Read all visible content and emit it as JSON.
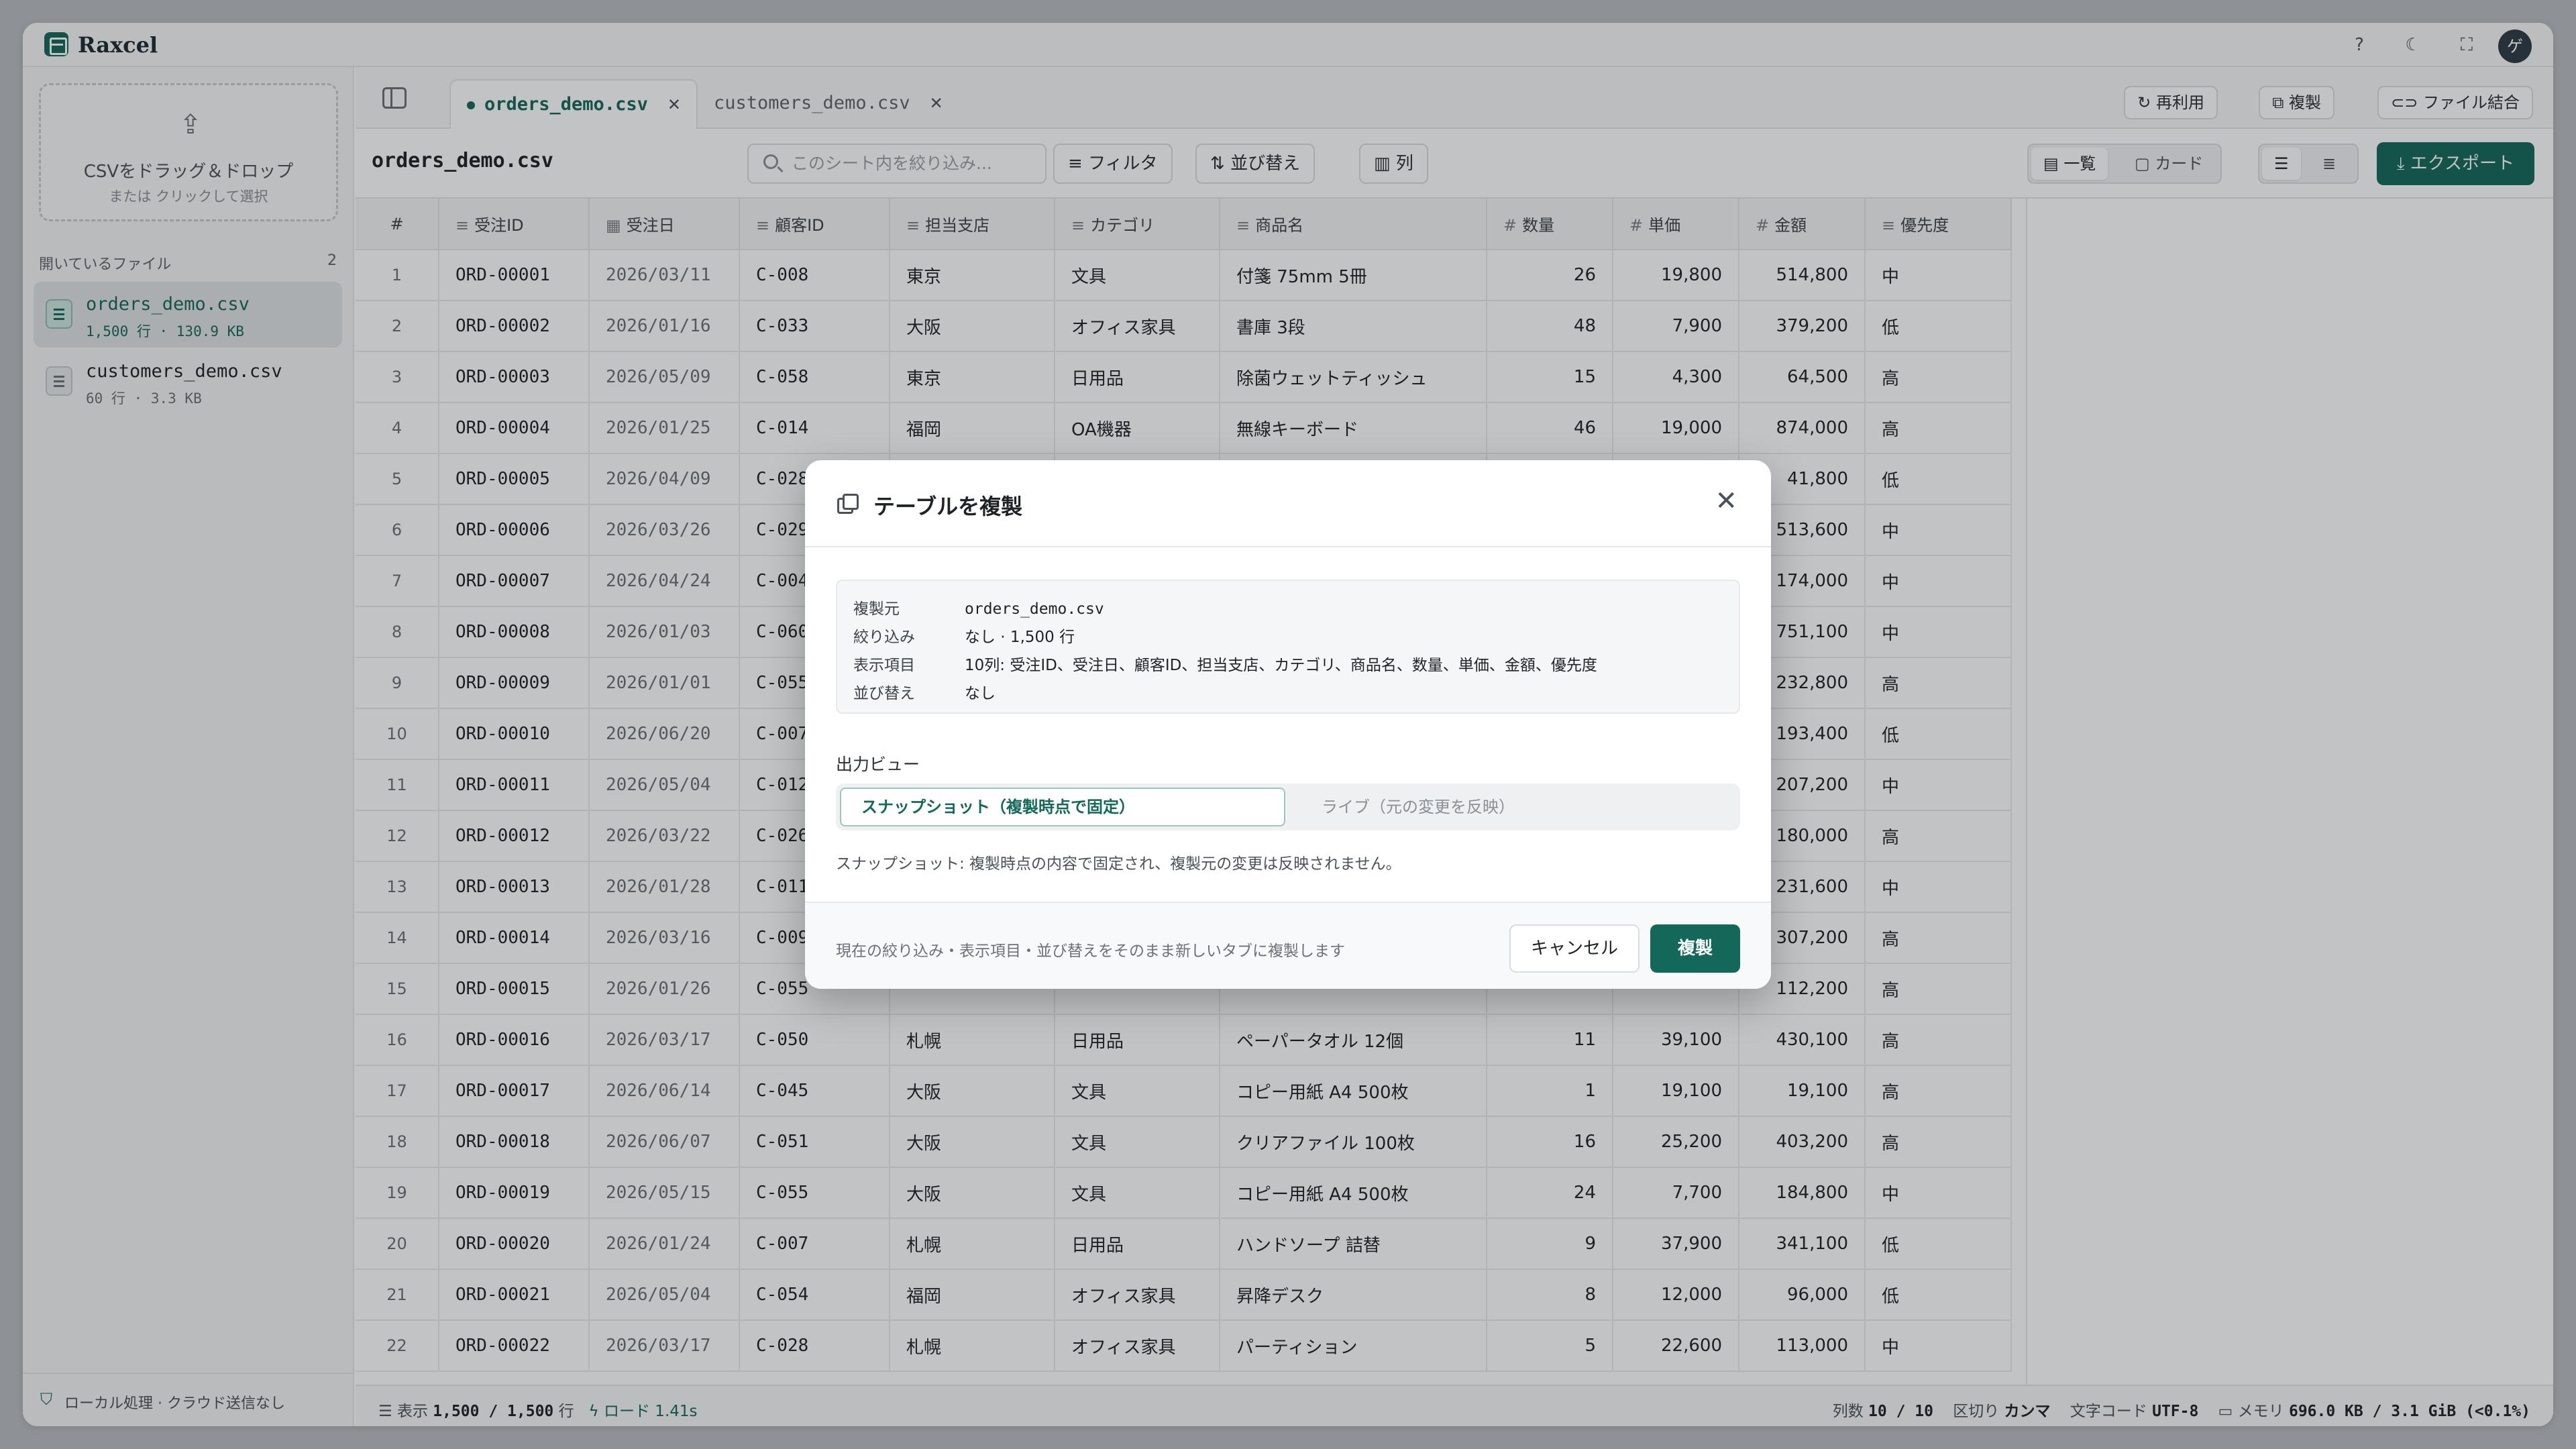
{
  "app": {
    "title": "Raxcel",
    "brand_color": "#14685a",
    "avatar_initial": "ゲ"
  },
  "sidebar": {
    "dropzone_title": "CSVをドラッグ＆ドロップ",
    "dropzone_sub": "または クリックして選択",
    "open_files_label": "開いているファイル",
    "open_files_count": "2",
    "files": [
      {
        "name": "orders_demo.csv",
        "meta": "1,500 行 · 130.9 KB",
        "active": true
      },
      {
        "name": "customers_demo.csv",
        "meta": "60 行 · 3.3 KB",
        "active": false
      }
    ],
    "local_note": "ローカル処理 · クラウド送信なし"
  },
  "tabs": [
    {
      "label": "orders_demo.csv",
      "active": true
    },
    {
      "label": "customers_demo.csv",
      "active": false
    }
  ],
  "top_actions": {
    "reuse": "再利用",
    "duplicate": "複製",
    "join": "ファイル結合"
  },
  "toolbar": {
    "sheet_title": "orders_demo.csv",
    "search_placeholder": "このシート内を絞り込み...",
    "filter": "フィルタ",
    "sort": "並び替え",
    "columns": "列",
    "view_list": "一覧",
    "view_card": "カード",
    "export": "エクスポート"
  },
  "table": {
    "columns": [
      "#",
      "受注ID",
      "受注日",
      "顧客ID",
      "担当支店",
      "カテゴリ",
      "商品名",
      "数量",
      "単価",
      "金額",
      "優先度"
    ],
    "rows": [
      [
        "1",
        "ORD-00001",
        "2026/03/11",
        "C-008",
        "東京",
        "文具",
        "付箋 75mm 5冊",
        "26",
        "19,800",
        "514,800",
        "中"
      ],
      [
        "2",
        "ORD-00002",
        "2026/01/16",
        "C-033",
        "大阪",
        "オフィス家具",
        "書庫 3段",
        "48",
        "7,900",
        "379,200",
        "低"
      ],
      [
        "3",
        "ORD-00003",
        "2026/05/09",
        "C-058",
        "東京",
        "日用品",
        "除菌ウェットティッシュ",
        "15",
        "4,300",
        "64,500",
        "高"
      ],
      [
        "4",
        "ORD-00004",
        "2026/01/25",
        "C-014",
        "福岡",
        "OA機器",
        "無線キーボード",
        "46",
        "19,000",
        "874,000",
        "高"
      ],
      [
        "5",
        "ORD-00005",
        "2026/04/09",
        "C-028",
        "",
        "",
        "",
        "",
        "",
        "41,800",
        "低"
      ],
      [
        "6",
        "ORD-00006",
        "2026/03/26",
        "C-029",
        "",
        "",
        "",
        "",
        "",
        "513,600",
        "中"
      ],
      [
        "7",
        "ORD-00007",
        "2026/04/24",
        "C-004",
        "",
        "",
        "",
        "",
        "",
        "174,000",
        "中"
      ],
      [
        "8",
        "ORD-00008",
        "2026/01/03",
        "C-060",
        "",
        "",
        "",
        "",
        "",
        "751,100",
        "中"
      ],
      [
        "9",
        "ORD-00009",
        "2026/01/01",
        "C-055",
        "",
        "",
        "",
        "",
        "",
        "232,800",
        "高"
      ],
      [
        "10",
        "ORD-00010",
        "2026/06/20",
        "C-007",
        "",
        "",
        "",
        "",
        "",
        "193,400",
        "低"
      ],
      [
        "11",
        "ORD-00011",
        "2026/05/04",
        "C-012",
        "",
        "",
        "",
        "",
        "",
        "207,200",
        "中"
      ],
      [
        "12",
        "ORD-00012",
        "2026/03/22",
        "C-026",
        "",
        "",
        "",
        "",
        "",
        "180,000",
        "高"
      ],
      [
        "13",
        "ORD-00013",
        "2026/01/28",
        "C-011",
        "",
        "",
        "",
        "",
        "",
        "231,600",
        "中"
      ],
      [
        "14",
        "ORD-00014",
        "2026/03/16",
        "C-009",
        "",
        "",
        "",
        "",
        "",
        "307,200",
        "高"
      ],
      [
        "15",
        "ORD-00015",
        "2026/01/26",
        "C-055",
        "",
        "",
        "",
        "",
        "",
        "112,200",
        "高"
      ],
      [
        "16",
        "ORD-00016",
        "2026/03/17",
        "C-050",
        "札幌",
        "日用品",
        "ペーパータオル 12個",
        "11",
        "39,100",
        "430,100",
        "高"
      ],
      [
        "17",
        "ORD-00017",
        "2026/06/14",
        "C-045",
        "大阪",
        "文具",
        "コピー用紙 A4 500枚",
        "1",
        "19,100",
        "19,100",
        "高"
      ],
      [
        "18",
        "ORD-00018",
        "2026/06/07",
        "C-051",
        "大阪",
        "文具",
        "クリアファイル 100枚",
        "16",
        "25,200",
        "403,200",
        "高"
      ],
      [
        "19",
        "ORD-00019",
        "2026/05/15",
        "C-055",
        "大阪",
        "文具",
        "コピー用紙 A4 500枚",
        "24",
        "7,700",
        "184,800",
        "中"
      ],
      [
        "20",
        "ORD-00020",
        "2026/01/24",
        "C-007",
        "札幌",
        "日用品",
        "ハンドソープ 詰替",
        "9",
        "37,900",
        "341,100",
        "低"
      ],
      [
        "21",
        "ORD-00021",
        "2026/05/04",
        "C-054",
        "福岡",
        "オフィス家具",
        "昇降デスク",
        "8",
        "12,000",
        "96,000",
        "低"
      ],
      [
        "22",
        "ORD-00022",
        "2026/03/17",
        "C-028",
        "札幌",
        "オフィス家具",
        "パーティション",
        "5",
        "22,600",
        "113,000",
        "中"
      ]
    ]
  },
  "status": {
    "display_label": "表示",
    "display_value": "1,500 / 1,500",
    "rows_unit": "行",
    "load_label": "ロード 1.41s",
    "columns_label": "列数",
    "columns_value": "10 / 10",
    "delimiter_label": "区切り",
    "delimiter_value": "カンマ",
    "encoding_label": "文字コード",
    "encoding_value": "UTF-8",
    "memory_label": "メモリ",
    "memory_value": "696.0 KB / 3.1 GiB (<0.1%)"
  },
  "dialog": {
    "title": "テーブルを複製",
    "summary": [
      {
        "key": "複製元",
        "value": "orders_demo.csv"
      },
      {
        "key": "絞り込み",
        "value": "なし · 1,500 行"
      },
      {
        "key": "表示項目",
        "value": "10列: 受注ID、受注日、顧客ID、担当支店、カテゴリ、商品名、数量、単価、金額、優先度"
      },
      {
        "key": "並び替え",
        "value": "なし"
      }
    ],
    "output_label": "出力ビュー",
    "option_snapshot": "スナップショット（複製時点で固定）",
    "option_live": "ライブ（元の変更を反映）",
    "selected_option": "snapshot",
    "description": "スナップショット: 複製時点の内容で固定され、複製元の変更は反映されません。",
    "footer_note": "現在の絞り込み・表示項目・並び替えをそのまま新しいタブに複製します",
    "cancel": "キャンセル",
    "confirm": "複製"
  }
}
